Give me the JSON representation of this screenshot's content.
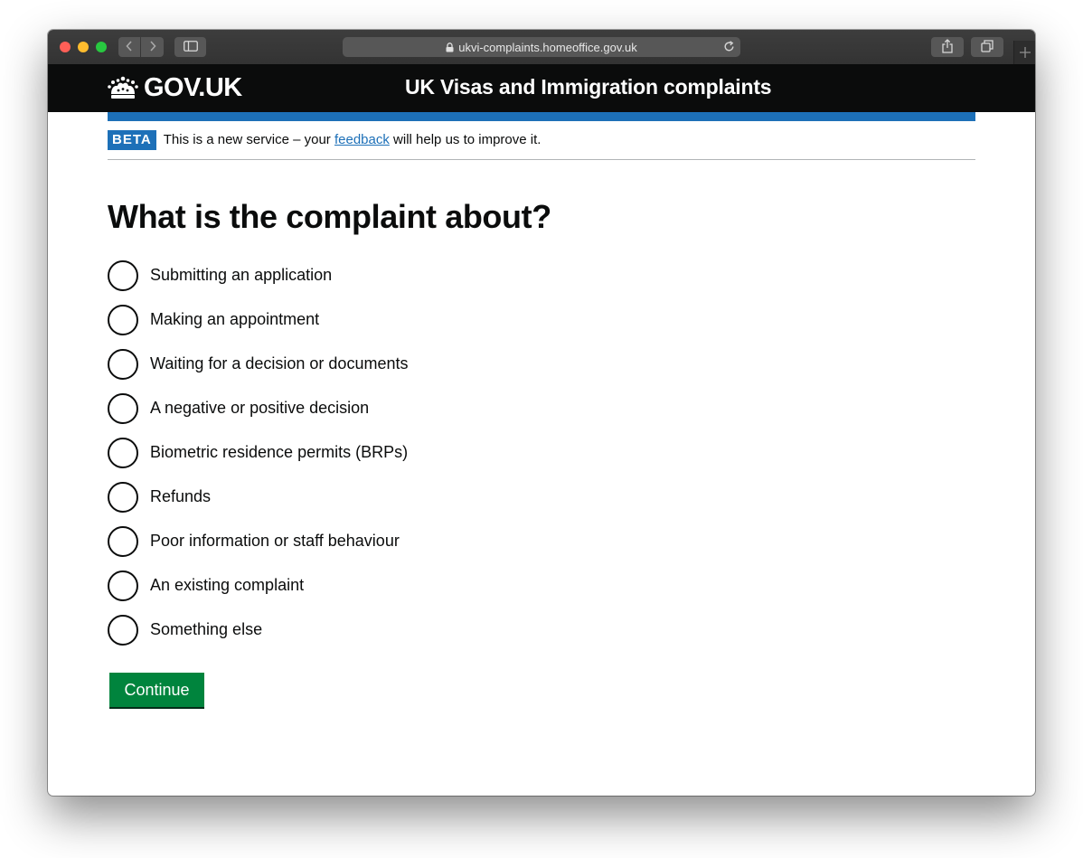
{
  "browser": {
    "url": "ukvi-complaints.homeoffice.gov.uk",
    "icons": {
      "back": "chevron-left-icon",
      "forward": "chevron-right-icon",
      "sidebar": "sidebar-icon",
      "lock": "lock-icon",
      "reload": "reload-icon",
      "share": "share-icon",
      "tabs": "tabs-overview-icon",
      "new_tab": "plus-icon"
    }
  },
  "header": {
    "logotype": "GOV.UK",
    "service_name": "UK Visas and Immigration complaints",
    "colors": {
      "background": "#0b0c0c",
      "accent_bar": "#1d70b8"
    }
  },
  "phase_banner": {
    "tag": "BETA",
    "text_before": "This is a new service – your ",
    "link_text": "feedback",
    "text_after": " will help us to improve it."
  },
  "main": {
    "title": "What is the complaint about?",
    "options": [
      {
        "label": "Submitting an application",
        "selected": false
      },
      {
        "label": "Making an appointment",
        "selected": false
      },
      {
        "label": "Waiting for a decision or documents",
        "selected": false
      },
      {
        "label": "A negative or positive decision",
        "selected": false
      },
      {
        "label": "Biometric residence permits (BRPs)",
        "selected": false
      },
      {
        "label": "Refunds",
        "selected": false
      },
      {
        "label": "Poor information or staff behaviour",
        "selected": false
      },
      {
        "label": "An existing complaint",
        "selected": false
      },
      {
        "label": "Something else",
        "selected": false
      }
    ],
    "continue_label": "Continue",
    "colors": {
      "button": "#00843d"
    }
  }
}
